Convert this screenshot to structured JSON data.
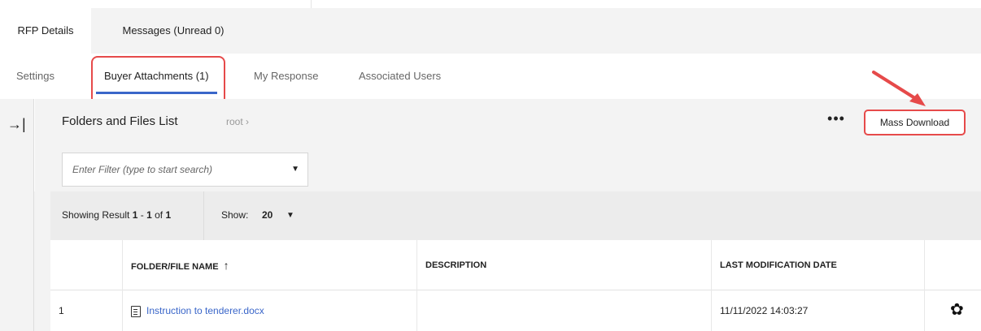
{
  "tabs_level1": [
    {
      "label": "RFP Details",
      "active": true
    },
    {
      "label": "Messages (Unread 0)",
      "active": false
    }
  ],
  "tabs_level2": [
    {
      "label": "Settings",
      "active": false
    },
    {
      "label": "Buyer Attachments (1)",
      "active": true
    },
    {
      "label": "My Response",
      "active": false
    },
    {
      "label": "Associated Users",
      "active": false
    }
  ],
  "rail": {
    "collapse_icon": "collapse-panel-icon",
    "collapse_glyph": "→|"
  },
  "panel": {
    "title": "Folders and Files List",
    "breadcrumb": "root ›",
    "more_glyph": "•••",
    "mass_download_label": "Mass Download"
  },
  "filter": {
    "placeholder": "Enter Filter (type to start search)"
  },
  "results": {
    "prefix": "Showing Result ",
    "from": "1",
    "dash": " - ",
    "to": "1",
    "of_text": " of ",
    "total": "1",
    "show_label": "Show:",
    "show_value": "20"
  },
  "table": {
    "columns": [
      "FOLDER/FILE NAME",
      "DESCRIPTION",
      "LAST MODIFICATION DATE"
    ],
    "sort_glyph": "↑",
    "rows": [
      {
        "index": "1",
        "name": "Instruction to tenderer.docx",
        "description": "",
        "modified": "11/11/2022 14:03:27"
      }
    ]
  },
  "colors": {
    "accent": "#3a66c9",
    "annotation_red": "#e64a4a",
    "panel_bg": "#f3f3f3"
  }
}
